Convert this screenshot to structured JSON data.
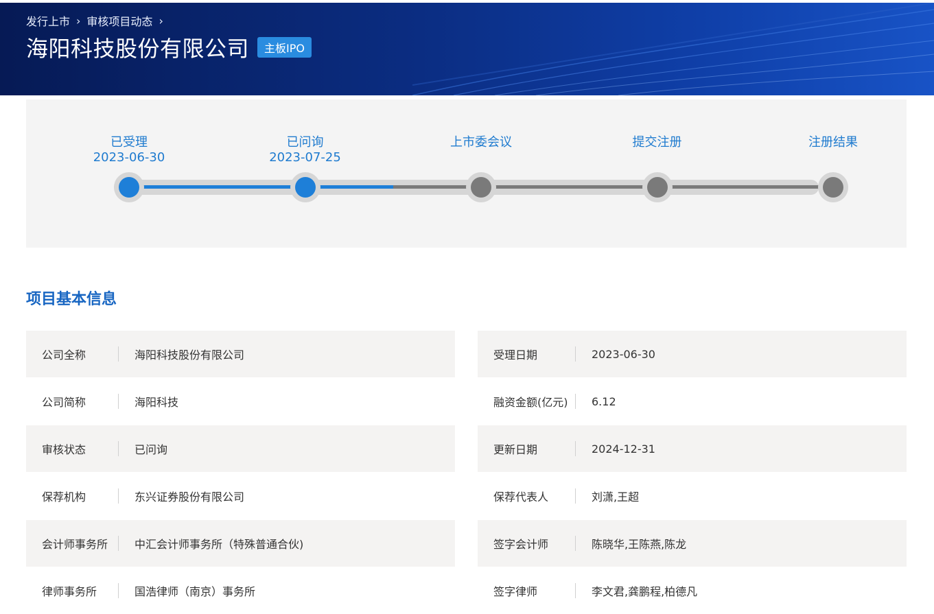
{
  "breadcrumb": {
    "items": [
      "发行上市",
      "审核项目动态"
    ]
  },
  "header": {
    "company_name": "海阳科技股份有限公司",
    "board_badge": "主板IPO"
  },
  "progress": {
    "steps": [
      {
        "label": "已受理",
        "date": "2023-06-30",
        "status": "done"
      },
      {
        "label": "已问询",
        "date": "2023-07-25",
        "status": "done"
      },
      {
        "label": "上市委会议",
        "date": "",
        "status": "pending"
      },
      {
        "label": "提交注册",
        "date": "",
        "status": "pending"
      },
      {
        "label": "注册结果",
        "date": "",
        "status": "pending"
      }
    ],
    "progress_fraction": 0.375
  },
  "colors": {
    "accent": "#1e7fd8",
    "pending": "#7a7a7a",
    "track": "#d6d6d6",
    "section_title": "#1866c2"
  },
  "section": {
    "title": "项目基本信息"
  },
  "info": {
    "left": [
      {
        "label": "公司全称",
        "value": "海阳科技股份有限公司"
      },
      {
        "label": "公司简称",
        "value": "海阳科技"
      },
      {
        "label": "审核状态",
        "value": "已问询"
      },
      {
        "label": "保荐机构",
        "value": "东兴证券股份有限公司"
      },
      {
        "label": "会计师事务所",
        "value": "中汇会计师事务所（特殊普通合伙)"
      },
      {
        "label": "律师事务所",
        "value": "国浩律师（南京）事务所"
      }
    ],
    "right": [
      {
        "label": "受理日期",
        "value": "2023-06-30"
      },
      {
        "label": "融资金额(亿元)",
        "value": "6.12"
      },
      {
        "label": "更新日期",
        "value": "2024-12-31"
      },
      {
        "label": "保荐代表人",
        "value": "刘潇,王超"
      },
      {
        "label": "签字会计师",
        "value": "陈晓华,王陈燕,陈龙"
      },
      {
        "label": "签字律师",
        "value": "李文君,龚鹏程,柏德凡"
      }
    ]
  }
}
